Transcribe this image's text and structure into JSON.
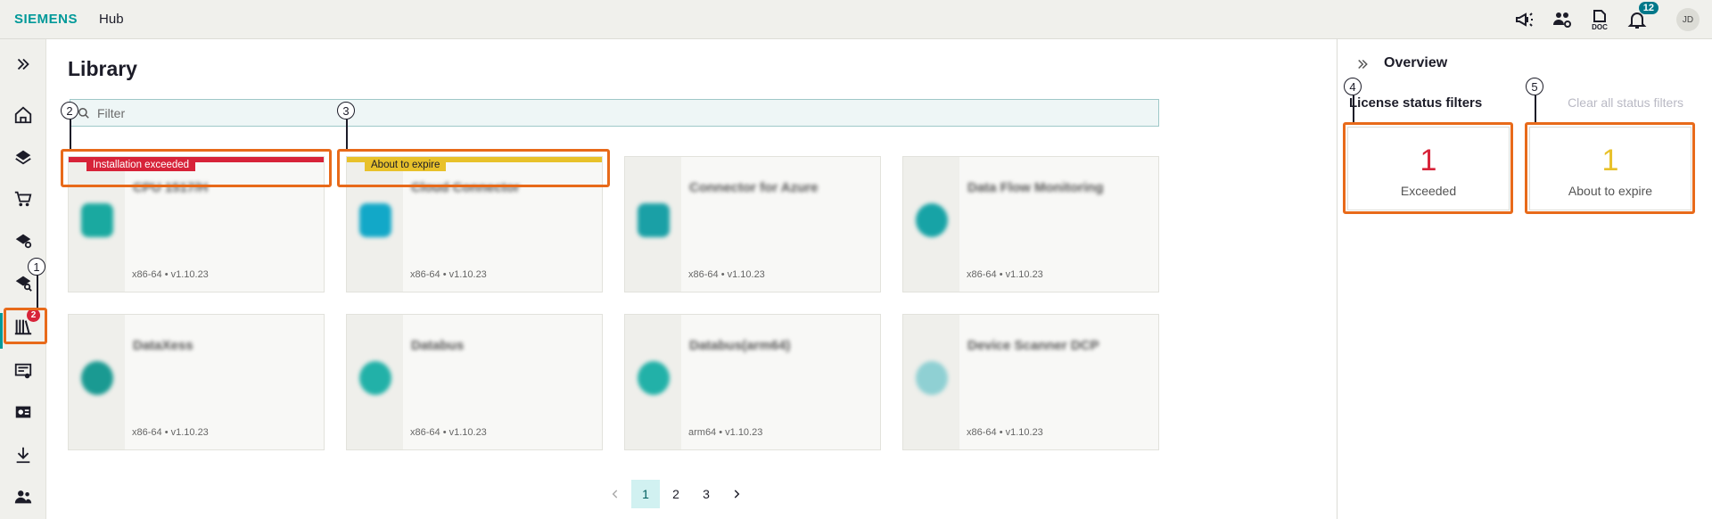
{
  "app": {
    "brand": "SIEMENS",
    "name": "Hub"
  },
  "topbar": {
    "doc_label": "DOC",
    "notification_count": "12",
    "avatar_initials": "JD"
  },
  "sidebar": {
    "library_badge": "2"
  },
  "page": {
    "title": "Library"
  },
  "filter": {
    "placeholder": "Filter"
  },
  "cards": [
    {
      "name": "CPU 1517/H",
      "meta": "x86-64 • v1.10.23",
      "status": "Installation exceeded",
      "status_color": "#d72339",
      "icon_color": "#1aa9a0"
    },
    {
      "name": "Cloud Connector",
      "meta": "x86-64 • v1.10.23",
      "status": "About to expire",
      "status_color": "#e8c12a",
      "icon_color": "#12a8c8"
    },
    {
      "name": "Connector for Azure",
      "meta": "x86-64 • v1.10.23",
      "status": "",
      "status_color": "",
      "icon_color": "#1aa0a6"
    },
    {
      "name": "Data Flow Monitoring",
      "meta": "x86-64 • v1.10.23",
      "status": "",
      "status_color": "",
      "icon_color": "#17a3a6"
    },
    {
      "name": "DataXess",
      "meta": "x86-64 • v1.10.23",
      "status": "",
      "status_color": "",
      "icon_color": "#1a9a92"
    },
    {
      "name": "Databus",
      "meta": "x86-64 • v1.10.23",
      "status": "",
      "status_color": "",
      "icon_color": "#22b1a8"
    },
    {
      "name": "Databus(arm64)",
      "meta": "arm64 • v1.10.23",
      "status": "",
      "status_color": "",
      "icon_color": "#22b1a8"
    },
    {
      "name": "Device Scanner DCP",
      "meta": "x86-64 • v1.10.23",
      "status": "",
      "status_color": "",
      "icon_color": "#8fd0d3"
    }
  ],
  "pagination": {
    "pages": [
      "1",
      "2",
      "3"
    ],
    "current": "1"
  },
  "overview": {
    "title": "Overview",
    "filters_title": "License status filters",
    "clear_label": "Clear all status filters",
    "exceeded": {
      "count": "1",
      "label": "Exceeded",
      "color": "#d72339"
    },
    "expiring": {
      "count": "1",
      "label": "About to expire",
      "color": "#e8c12a"
    }
  },
  "callouts": [
    "1",
    "2",
    "3",
    "4",
    "5"
  ],
  "colors": {
    "accent": "#009999",
    "highlight": "#e86a1a"
  }
}
